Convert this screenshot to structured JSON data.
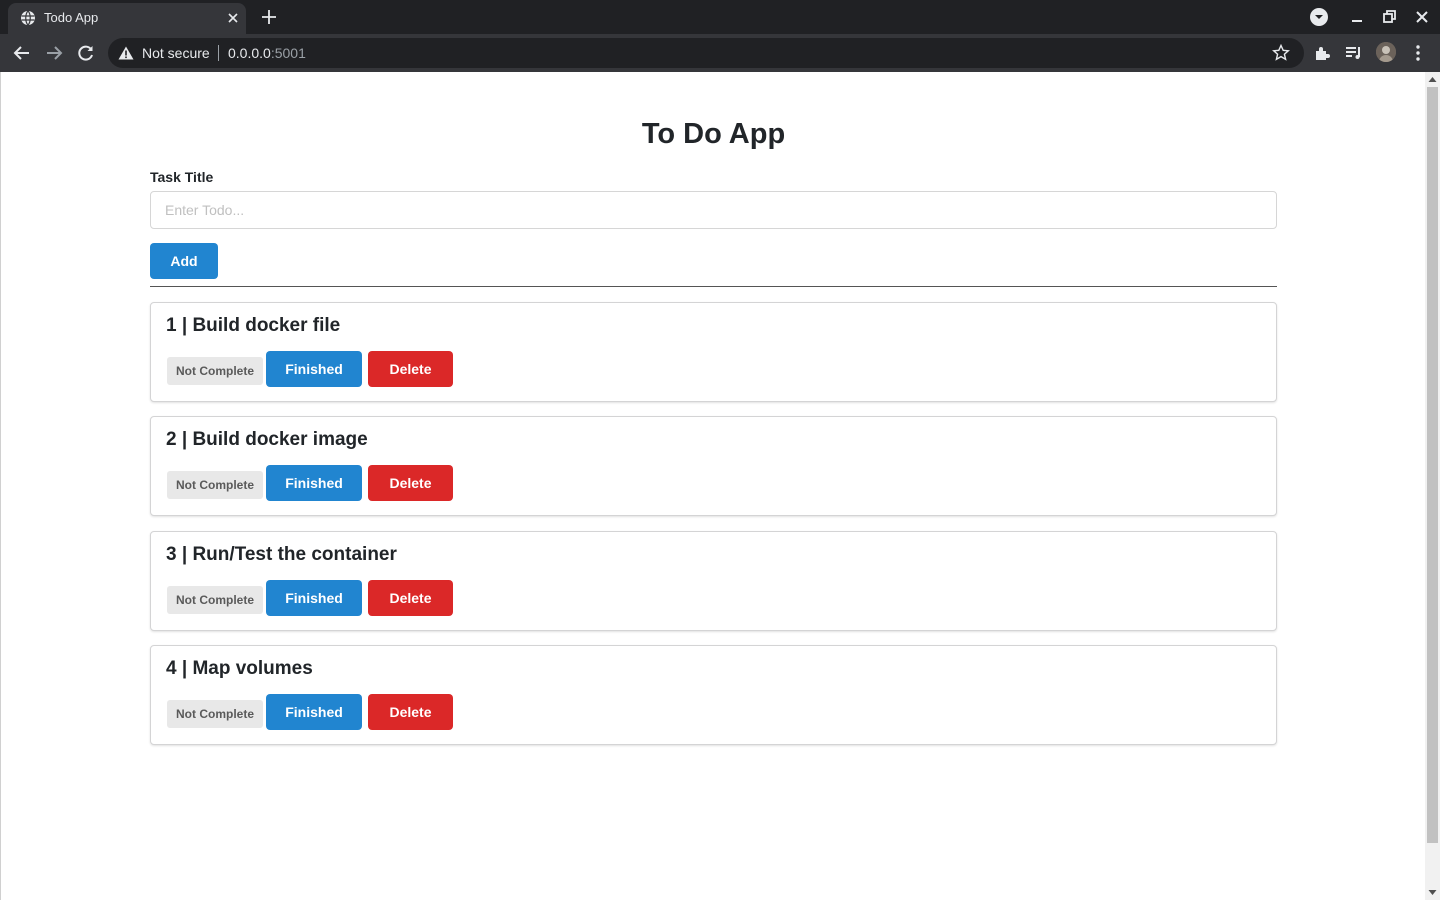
{
  "browser": {
    "tab_title": "Todo App",
    "security_label": "Not secure",
    "url_host": "0.0.0.0",
    "url_port": ":5001"
  },
  "page": {
    "title": "To Do App",
    "input_label": "Task Title",
    "input_placeholder": "Enter Todo...",
    "input_value": "",
    "add_label": "Add"
  },
  "tasks": [
    {
      "title": "1 | Build docker file",
      "status": "Not Complete",
      "finish_label": "Finished",
      "delete_label": "Delete"
    },
    {
      "title": "2 | Build docker image",
      "status": "Not Complete",
      "finish_label": "Finished",
      "delete_label": "Delete"
    },
    {
      "title": "3 | Run/Test the container",
      "status": "Not Complete",
      "finish_label": "Finished",
      "delete_label": "Delete"
    },
    {
      "title": "4 | Map volumes",
      "status": "Not Complete",
      "finish_label": "Finished",
      "delete_label": "Delete"
    }
  ],
  "colors": {
    "primary": "#2185d0",
    "danger": "#db2828",
    "badge_bg": "#e8e8e8",
    "chrome_dark": "#202124",
    "chrome_toolbar": "#35363a"
  },
  "icons": [
    "globe-icon",
    "close-icon",
    "plus-icon",
    "media-dropdown-icon",
    "minimize-icon",
    "restore-icon",
    "window-close-icon",
    "back-icon",
    "forward-icon",
    "reload-icon",
    "warning-icon",
    "star-icon",
    "extensions-icon",
    "media-queue-icon",
    "more-icon"
  ]
}
